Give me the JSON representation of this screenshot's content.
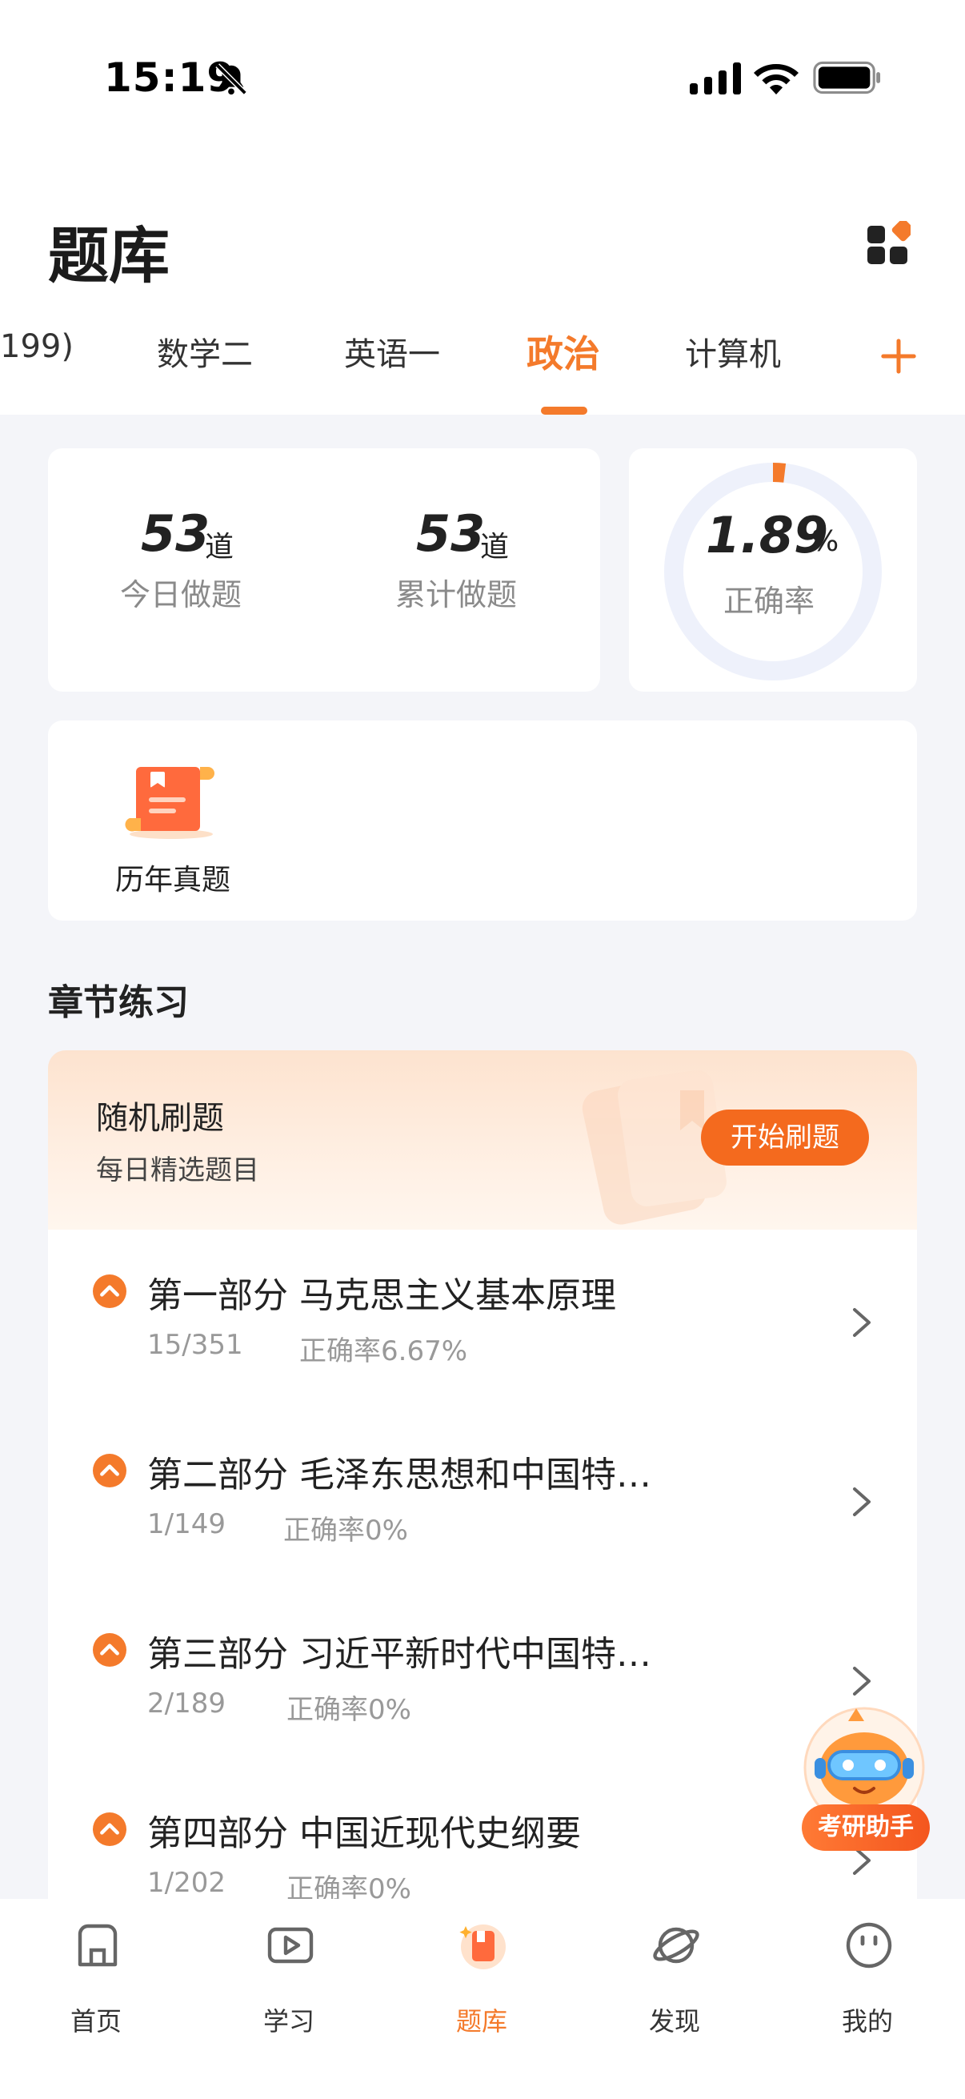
{
  "status_bar": {
    "time": "15:19"
  },
  "header": {
    "title": "题库"
  },
  "tabs": [
    {
      "label": "199)"
    },
    {
      "label": "数学二"
    },
    {
      "label": "英语一"
    },
    {
      "label": "政治"
    },
    {
      "label": "计算机"
    }
  ],
  "active_tab": "政治",
  "stats": {
    "today": {
      "value": "53",
      "unit": "道",
      "label": "今日做题"
    },
    "total": {
      "value": "53",
      "unit": "道",
      "label": "累计做题"
    },
    "accuracy": {
      "value": "1.89",
      "unit": "%",
      "label": "正确率",
      "fraction": 0.0189
    }
  },
  "past_exams": {
    "label": "历年真题"
  },
  "section": {
    "title": "章节练习"
  },
  "random_practice": {
    "title": "随机刷题",
    "subtitle": "每日精选题目",
    "button": "开始刷题"
  },
  "chapters": [
    {
      "title": "第一部分 马克思主义基本原理",
      "count": "15/351",
      "accuracy": "正确率6.67%"
    },
    {
      "title": "第二部分 毛泽东思想和中国特…",
      "count": "1/149",
      "accuracy": "正确率0%"
    },
    {
      "title": "第三部分 习近平新时代中国特…",
      "count": "2/189",
      "accuracy": "正确率0%"
    },
    {
      "title": "第四部分 中国近现代史纲要",
      "count": "1/202",
      "accuracy": "正确率0%"
    }
  ],
  "assistant": {
    "label": "考研助手"
  },
  "bottom_nav": [
    {
      "label": "首页",
      "icon": "home-icon"
    },
    {
      "label": "学习",
      "icon": "play-icon"
    },
    {
      "label": "题库",
      "icon": "question-bank-icon"
    },
    {
      "label": "发现",
      "icon": "planet-icon"
    },
    {
      "label": "我的",
      "icon": "profile-icon"
    }
  ],
  "colors": {
    "accent": "#f47a2b",
    "button": "#f46a1e",
    "background": "#f4f5f9"
  }
}
